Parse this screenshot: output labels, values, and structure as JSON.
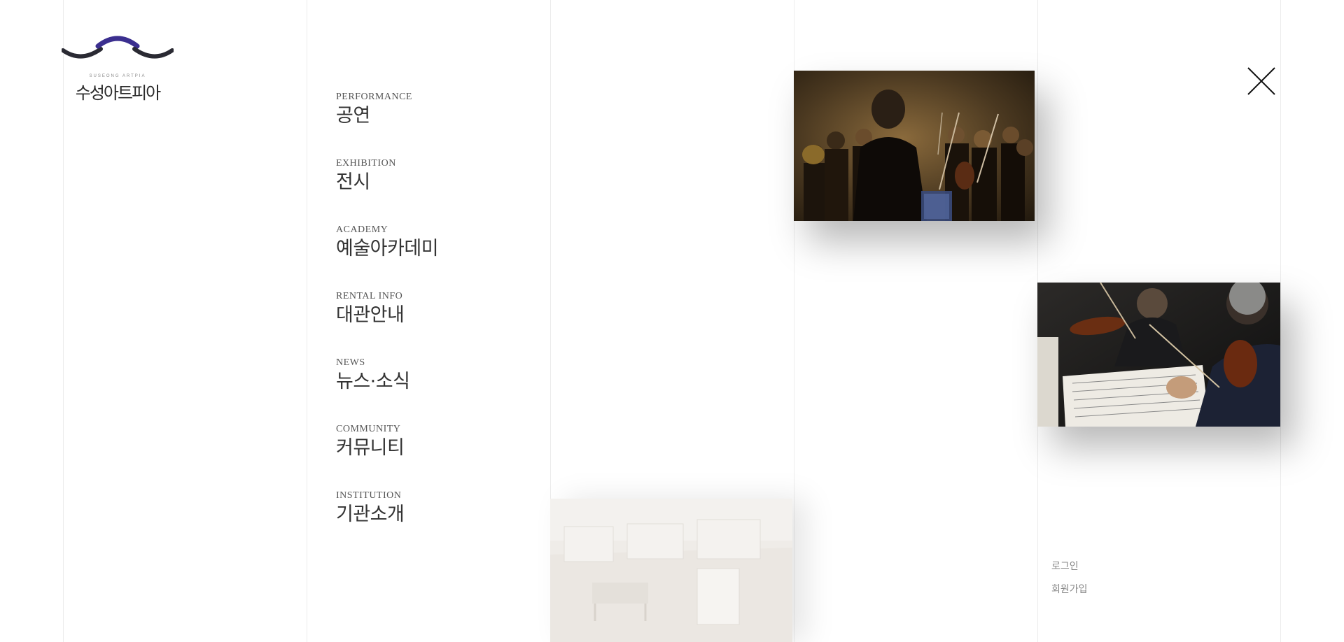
{
  "logo": {
    "subtitle": "SUSEONG ARTPIA",
    "name": "수성아트피아",
    "colors": {
      "arch": "#3b2f8f",
      "waves": "#2a2a33"
    }
  },
  "menu": {
    "items": [
      {
        "en": "PERFORMANCE",
        "ko": "공연"
      },
      {
        "en": "EXHIBITION",
        "ko": "전시"
      },
      {
        "en": "ACADEMY",
        "ko": "예술아카데미"
      },
      {
        "en": "RENTAL INFO",
        "ko": "대관안내"
      },
      {
        "en": "NEWS",
        "ko": "뉴스·소식"
      },
      {
        "en": "COMMUNITY",
        "ko": "커뮤니티"
      },
      {
        "en": "INSTITUTION",
        "ko": "기관소개"
      }
    ]
  },
  "close": {
    "icon": "close-icon"
  },
  "auth": {
    "login": "로그인",
    "signup": "회원가입"
  },
  "colors": {
    "text": "#333333",
    "muted": "#888888",
    "divider": "#ececec",
    "background": "#ffffff"
  }
}
